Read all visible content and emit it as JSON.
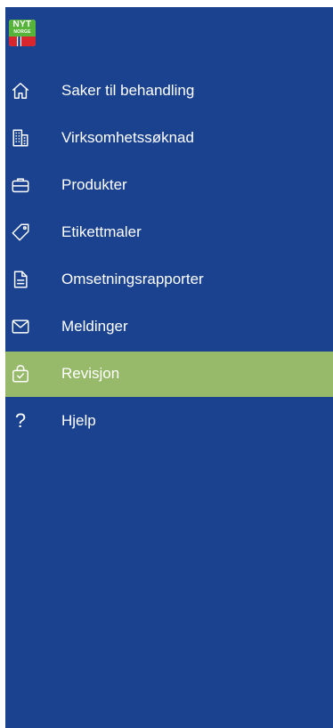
{
  "brand": {
    "logo_line1": "NYT",
    "logo_line2": "NORGE",
    "logo_green": "#56b43b",
    "flag_red": "#d7262e",
    "flag_blue": "#1a428f"
  },
  "theme": {
    "sidebar_bg": "#1a428f",
    "active_bg": "#96b96a",
    "text_color": "#ffffff"
  },
  "menu": {
    "items": [
      {
        "label": "Saker til behandling",
        "icon": "home-icon",
        "active": false
      },
      {
        "label": "Virksomhetssøknad",
        "icon": "building-icon",
        "active": false
      },
      {
        "label": "Produkter",
        "icon": "briefcase-icon",
        "active": false
      },
      {
        "label": "Etikettmaler",
        "icon": "tag-icon",
        "active": false
      },
      {
        "label": "Omsetningsrapporter",
        "icon": "document-icon",
        "active": false
      },
      {
        "label": "Meldinger",
        "icon": "envelope-icon",
        "active": false
      },
      {
        "label": "Revisjon",
        "icon": "bag-check-icon",
        "active": true
      },
      {
        "label": "Hjelp",
        "icon": "question-icon",
        "glyph": "?",
        "active": false
      }
    ]
  }
}
